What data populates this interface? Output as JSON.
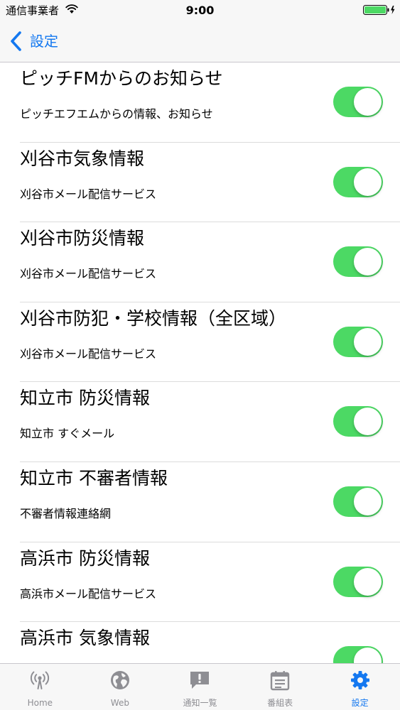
{
  "status_bar": {
    "carrier": "通信事業者",
    "time": "9:00"
  },
  "nav": {
    "back_label": "設定"
  },
  "items": [
    {
      "title": "ピッチFMからのお知らせ",
      "subtitle": "ピッチエフエムからの情報、お知らせ",
      "enabled": true
    },
    {
      "title": "刈谷市気象情報",
      "subtitle": "刈谷市メール配信サービス",
      "enabled": true
    },
    {
      "title": "刈谷市防災情報",
      "subtitle": "刈谷市メール配信サービス",
      "enabled": true
    },
    {
      "title": "刈谷市防犯・学校情報（全区域）",
      "subtitle": "刈谷市メール配信サービス",
      "enabled": true
    },
    {
      "title": "知立市 防災情報",
      "subtitle": "知立市 すぐメール",
      "enabled": true
    },
    {
      "title": "知立市 不審者情報",
      "subtitle": "不審者情報連絡網",
      "enabled": true
    },
    {
      "title": "高浜市 防災情報",
      "subtitle": "高浜市メール配信サービス",
      "enabled": true
    },
    {
      "title": "高浜市 気象情報",
      "subtitle": "",
      "enabled": true
    }
  ],
  "tabs": [
    {
      "label": "Home",
      "icon": "radio-tower-icon",
      "active": false
    },
    {
      "label": "Web",
      "icon": "globe-icon",
      "active": false
    },
    {
      "label": "通知一覧",
      "icon": "notification-list-icon",
      "active": false
    },
    {
      "label": "番組表",
      "icon": "calendar-icon",
      "active": false
    },
    {
      "label": "設定",
      "icon": "gear-icon",
      "active": true
    }
  ],
  "colors": {
    "accent": "#1478f0",
    "toggle_on": "#4cd964",
    "tab_inactive": "#8e8e93",
    "battery": "#4cd964"
  }
}
